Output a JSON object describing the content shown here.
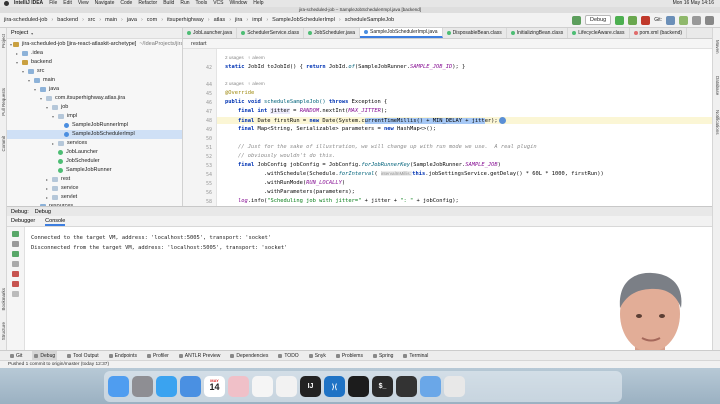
{
  "macbar": {
    "app": "IntelliJ IDEA",
    "menus": [
      "File",
      "Edit",
      "View",
      "Navigate",
      "Code",
      "Refactor",
      "Build",
      "Run",
      "Tools",
      "VCS",
      "Window",
      "Help"
    ],
    "clock": "Mon 16 May 14:16"
  },
  "window": {
    "title": "jira-scheduled-job – SampleJobSchedulerImpl.java [backend]"
  },
  "breadcrumbs": [
    "jira-scheduled-job",
    "backend",
    "src",
    "main",
    "java",
    "com",
    "itsuperhighway",
    "atlas",
    "jira",
    "impl",
    "SampleJobSchedulerImpl",
    "scheduleSampleJob"
  ],
  "run_config": "Debug",
  "git_label": "Git:",
  "left_stripe": [
    "Project",
    "Pull Requests",
    "Commit",
    "Bookmarks",
    "Structure"
  ],
  "right_stripe": [
    "Maven",
    "Database",
    "Notifications"
  ],
  "project": {
    "header": "Project",
    "tree": [
      {
        "label": "jira-scheduled-job [jira-react-atlaskit-archetype]",
        "dim": "~/IdeaProjects/jira",
        "icon": "f-mod",
        "depth": 0,
        "arrow": "▾"
      },
      {
        "label": ".idea",
        "dim": "",
        "icon": "f-folder",
        "depth": 1,
        "arrow": "▸"
      },
      {
        "label": "backend",
        "dim": "",
        "icon": "f-mod",
        "depth": 1,
        "arrow": "▾"
      },
      {
        "label": "src",
        "dim": "",
        "icon": "f-folder",
        "depth": 2,
        "arrow": "▾"
      },
      {
        "label": "main",
        "dim": "",
        "icon": "f-folder",
        "depth": 3,
        "arrow": "▾"
      },
      {
        "label": "java",
        "dim": "",
        "icon": "f-folder",
        "depth": 4,
        "arrow": "▾"
      },
      {
        "label": "com.itsuperhighway.atlas.jira",
        "dim": "",
        "icon": "f-pkg",
        "depth": 5,
        "arrow": "▾"
      },
      {
        "label": "job",
        "dim": "",
        "icon": "f-pkg",
        "depth": 6,
        "arrow": "▾"
      },
      {
        "label": "impl",
        "dim": "",
        "icon": "f-pkg",
        "depth": 7,
        "arrow": "▾"
      },
      {
        "label": "SampleJobRunnerImpl",
        "dim": "",
        "icon": "f-java",
        "depth": 8,
        "arrow": ""
      },
      {
        "label": "SampleJobSchedulerImpl",
        "dim": "",
        "icon": "f-java",
        "depth": 8,
        "arrow": "",
        "sel": true
      },
      {
        "label": "services",
        "dim": "",
        "icon": "f-pkg",
        "depth": 7,
        "arrow": "▸"
      },
      {
        "label": "JobLauncher",
        "dim": "",
        "icon": "f-iface",
        "depth": 7,
        "arrow": ""
      },
      {
        "label": "JobScheduler",
        "dim": "",
        "icon": "f-iface",
        "depth": 7,
        "arrow": ""
      },
      {
        "label": "SampleJobRunner",
        "dim": "",
        "icon": "f-iface",
        "depth": 7,
        "arrow": ""
      },
      {
        "label": "rest",
        "dim": "",
        "icon": "f-pkg",
        "depth": 6,
        "arrow": "▸"
      },
      {
        "label": "service",
        "dim": "",
        "icon": "f-pkg",
        "depth": 6,
        "arrow": "▸"
      },
      {
        "label": "servlet",
        "dim": "",
        "icon": "f-pkg",
        "depth": 6,
        "arrow": "▸"
      },
      {
        "label": "resources",
        "dim": "",
        "icon": "f-folder",
        "depth": 4,
        "arrow": "▸"
      },
      {
        "label": "test",
        "dim": "",
        "icon": "f-folder",
        "depth": 3,
        "arrow": "▸"
      }
    ]
  },
  "tabs": [
    {
      "label": "JobLauncher.java",
      "color": "#4dbd74",
      "active": false
    },
    {
      "label": "SchedulerService.class",
      "color": "#4dbd74",
      "active": false
    },
    {
      "label": "JobScheduler.java",
      "color": "#4dbd74",
      "active": false
    },
    {
      "label": "SampleJobSchedulerImpl.java",
      "color": "#4b8ee0",
      "active": true
    },
    {
      "label": "DisposableBean.class",
      "color": "#4dbd74",
      "active": false
    },
    {
      "label": "InitializingBean.class",
      "color": "#4dbd74",
      "active": false
    },
    {
      "label": "LifecycleAware.class",
      "color": "#4dbd74",
      "active": false
    },
    {
      "label": "pom.xml (backend)",
      "color": "#e06c6c",
      "active": false
    }
  ],
  "editor_toolbar": "restart",
  "gutter_lines": [
    "",
    "",
    "",
    "",
    "",
    "",
    "",
    "",
    "",
    "",
    "",
    "",
    "",
    "",
    "",
    "",
    "",
    "",
    "",
    "",
    ""
  ],
  "line_numbers": [
    "",
    "42",
    "43",
    "44",
    "45",
    "46",
    "47",
    "48",
    "49",
    "50",
    "51",
    "52",
    "53",
    "54",
    "55",
    "56",
    "57",
    "58",
    "59",
    "",
    ""
  ],
  "code": {
    "usages1": "2 usages   ♀ aleem",
    "l42a": "static ",
    "l42b": "JobId ",
    "l42c": "toJobId() { ",
    "l42d": "return ",
    "l42e": "JobId.",
    "l42f": "of",
    "l42g": "(SampleJobRunner.",
    "l42h": "SAMPLE_JOB_ID",
    "l42i": "); }",
    "usages2": "2 usages   ♀ aleem",
    "l45": "@Override",
    "l46a": "public void ",
    "l46b": "scheduleSampleJob() ",
    "l46c": "throws ",
    "l46d": "Exception {",
    "l47a": "final int ",
    "l47b": "jitter",
    "l47c": " = ",
    "l47d": "RANDOM",
    "l47e": ".nextInt(",
    "l47f": "MAX_JITTER",
    "l47g": ");",
    "l48a": "final ",
    "l48b": "Date firstRun = ",
    "l48c": "new ",
    "l48d": "Date(System.c",
    "l48e": "urrentTimeMillis() + MIN_DELAY + jitt",
    "l48f": "er);",
    "l49a": "final ",
    "l49b": "Map<String, Serializable> parameters = ",
    "l49c": "new ",
    "l49d": "HashMap<>();",
    "l51": "// Just for the sake of illustration, we will change up with run mode we use.  A real plugin",
    "l52": "// obviously wouldn't do this.",
    "l53a": "final ",
    "l53b": "JobConfig jobConfig = JobConfig.",
    "l53c": "forJobRunnerKey",
    "l53d": "(SampleJobRunner.",
    "l53e": "SAMPLE_JOB",
    "l53f": ")",
    "l54a": ".withSchedule(Schedule.",
    "l54b": "forInterval",
    "l54c": "( ",
    "l54d": "intervalInMillis: ",
    "l54e": "this",
    "l54f": ".jobSettingsService.getDelay() * 60L * 1000, firstRun))",
    "l55a": ".withRunMode(",
    "l55b": "RUN_LOCALLY",
    "l55c": ")",
    "l56": ".withParameters(parameters);",
    "l58a": "log",
    "l58b": ".info(",
    "l58c": "\"Scheduling job with jitter=\"",
    "l58d": " + jitter + ",
    "l58e": "\": \"",
    "l58f": " + jobConfig);"
  },
  "debug": {
    "header": "Debug:",
    "session": "Debug",
    "tabs": [
      "Debugger",
      "Console"
    ],
    "console": [
      "Connected to the target VM, address: 'localhost:5005', transport: 'socket'",
      "Disconnected from the target VM, address: 'localhost:5005', transport: 'socket'"
    ]
  },
  "bottom_tools": [
    "Git",
    "Debug",
    "Tool Output",
    "Endpoints",
    "Profiler",
    "ANTLR Preview",
    "Dependencies",
    "TODO",
    "Snyk",
    "Problems",
    "Spring",
    "Terminal"
  ],
  "status": "Pushed 1 commit to origin/master (today 12:37)",
  "dock": {
    "apps": [
      {
        "name": "finder-app",
        "color": "#4f9df0",
        "label": ""
      },
      {
        "name": "system-settings-app",
        "color": "#8e8e93",
        "label": ""
      },
      {
        "name": "safari-app",
        "color": "#3aa3f0",
        "label": ""
      },
      {
        "name": "mail-app",
        "color": "#4a90e2",
        "label": ""
      },
      {
        "name": "calendar-app",
        "color": "#ffffff",
        "label": "14",
        "top": "MAY"
      },
      {
        "name": "photos-app",
        "color": "#f0c0c8",
        "label": ""
      },
      {
        "name": "freeform-app",
        "color": "#f5f5f5",
        "label": ""
      },
      {
        "name": "chrome-app",
        "color": "#f2f2f2",
        "label": ""
      },
      {
        "name": "intellij-app",
        "color": "#222222",
        "label": "IJ"
      },
      {
        "name": "vscode-app",
        "color": "#1f73c5",
        "label": "⟩⟨"
      },
      {
        "name": "clock-app",
        "color": "#1c1c1c",
        "label": ""
      },
      {
        "name": "terminal-app",
        "color": "#2a2a2a",
        "label": "$_"
      },
      {
        "name": "iterm-app",
        "color": "#333333",
        "label": ""
      },
      {
        "name": "downloads-folder",
        "color": "#6aa7e8",
        "label": ""
      },
      {
        "name": "trash",
        "color": "#e8e8e8",
        "label": ""
      }
    ]
  }
}
